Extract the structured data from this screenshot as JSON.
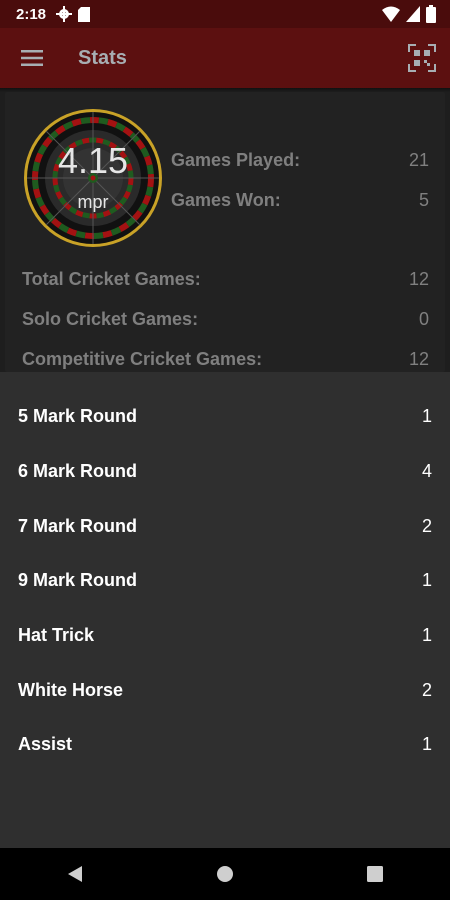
{
  "status_bar": {
    "time": "2:18",
    "icons": [
      "gear-icon",
      "sd-card-icon",
      "wifi-icon",
      "signal-icon",
      "battery-icon"
    ]
  },
  "app_bar": {
    "title": "Stats",
    "menu_icon": "hamburger-menu-icon",
    "action_icon": "qr-scan-icon"
  },
  "summary": {
    "mpr_value": "4.15",
    "mpr_label": "mpr",
    "games_played_label": "Games Played:",
    "games_played": "21",
    "games_won_label": "Games Won:",
    "games_won": "5",
    "total_cricket_label": "Total Cricket Games:",
    "total_cricket": "12",
    "solo_cricket_label": "Solo Cricket Games:",
    "solo_cricket": "0",
    "competitive_cricket_label": "Competitive Cricket Games:",
    "competitive_cricket": "12"
  },
  "marks": [
    {
      "label": "5 Mark Round",
      "count": "1"
    },
    {
      "label": "6 Mark Round",
      "count": "4"
    },
    {
      "label": "7 Mark Round",
      "count": "2"
    },
    {
      "label": "9 Mark Round",
      "count": "1"
    },
    {
      "label": "Hat Trick",
      "count": "1"
    },
    {
      "label": "White Horse",
      "count": "2"
    },
    {
      "label": "Assist",
      "count": "1"
    }
  ],
  "nav_bar": {
    "icons": [
      "back-icon",
      "home-icon",
      "recents-icon"
    ]
  },
  "colors": {
    "status_bar": "#4a0c0c",
    "app_bar": "#5c1010",
    "background": "#1e1e1e",
    "panel": "#2f2f2f"
  }
}
